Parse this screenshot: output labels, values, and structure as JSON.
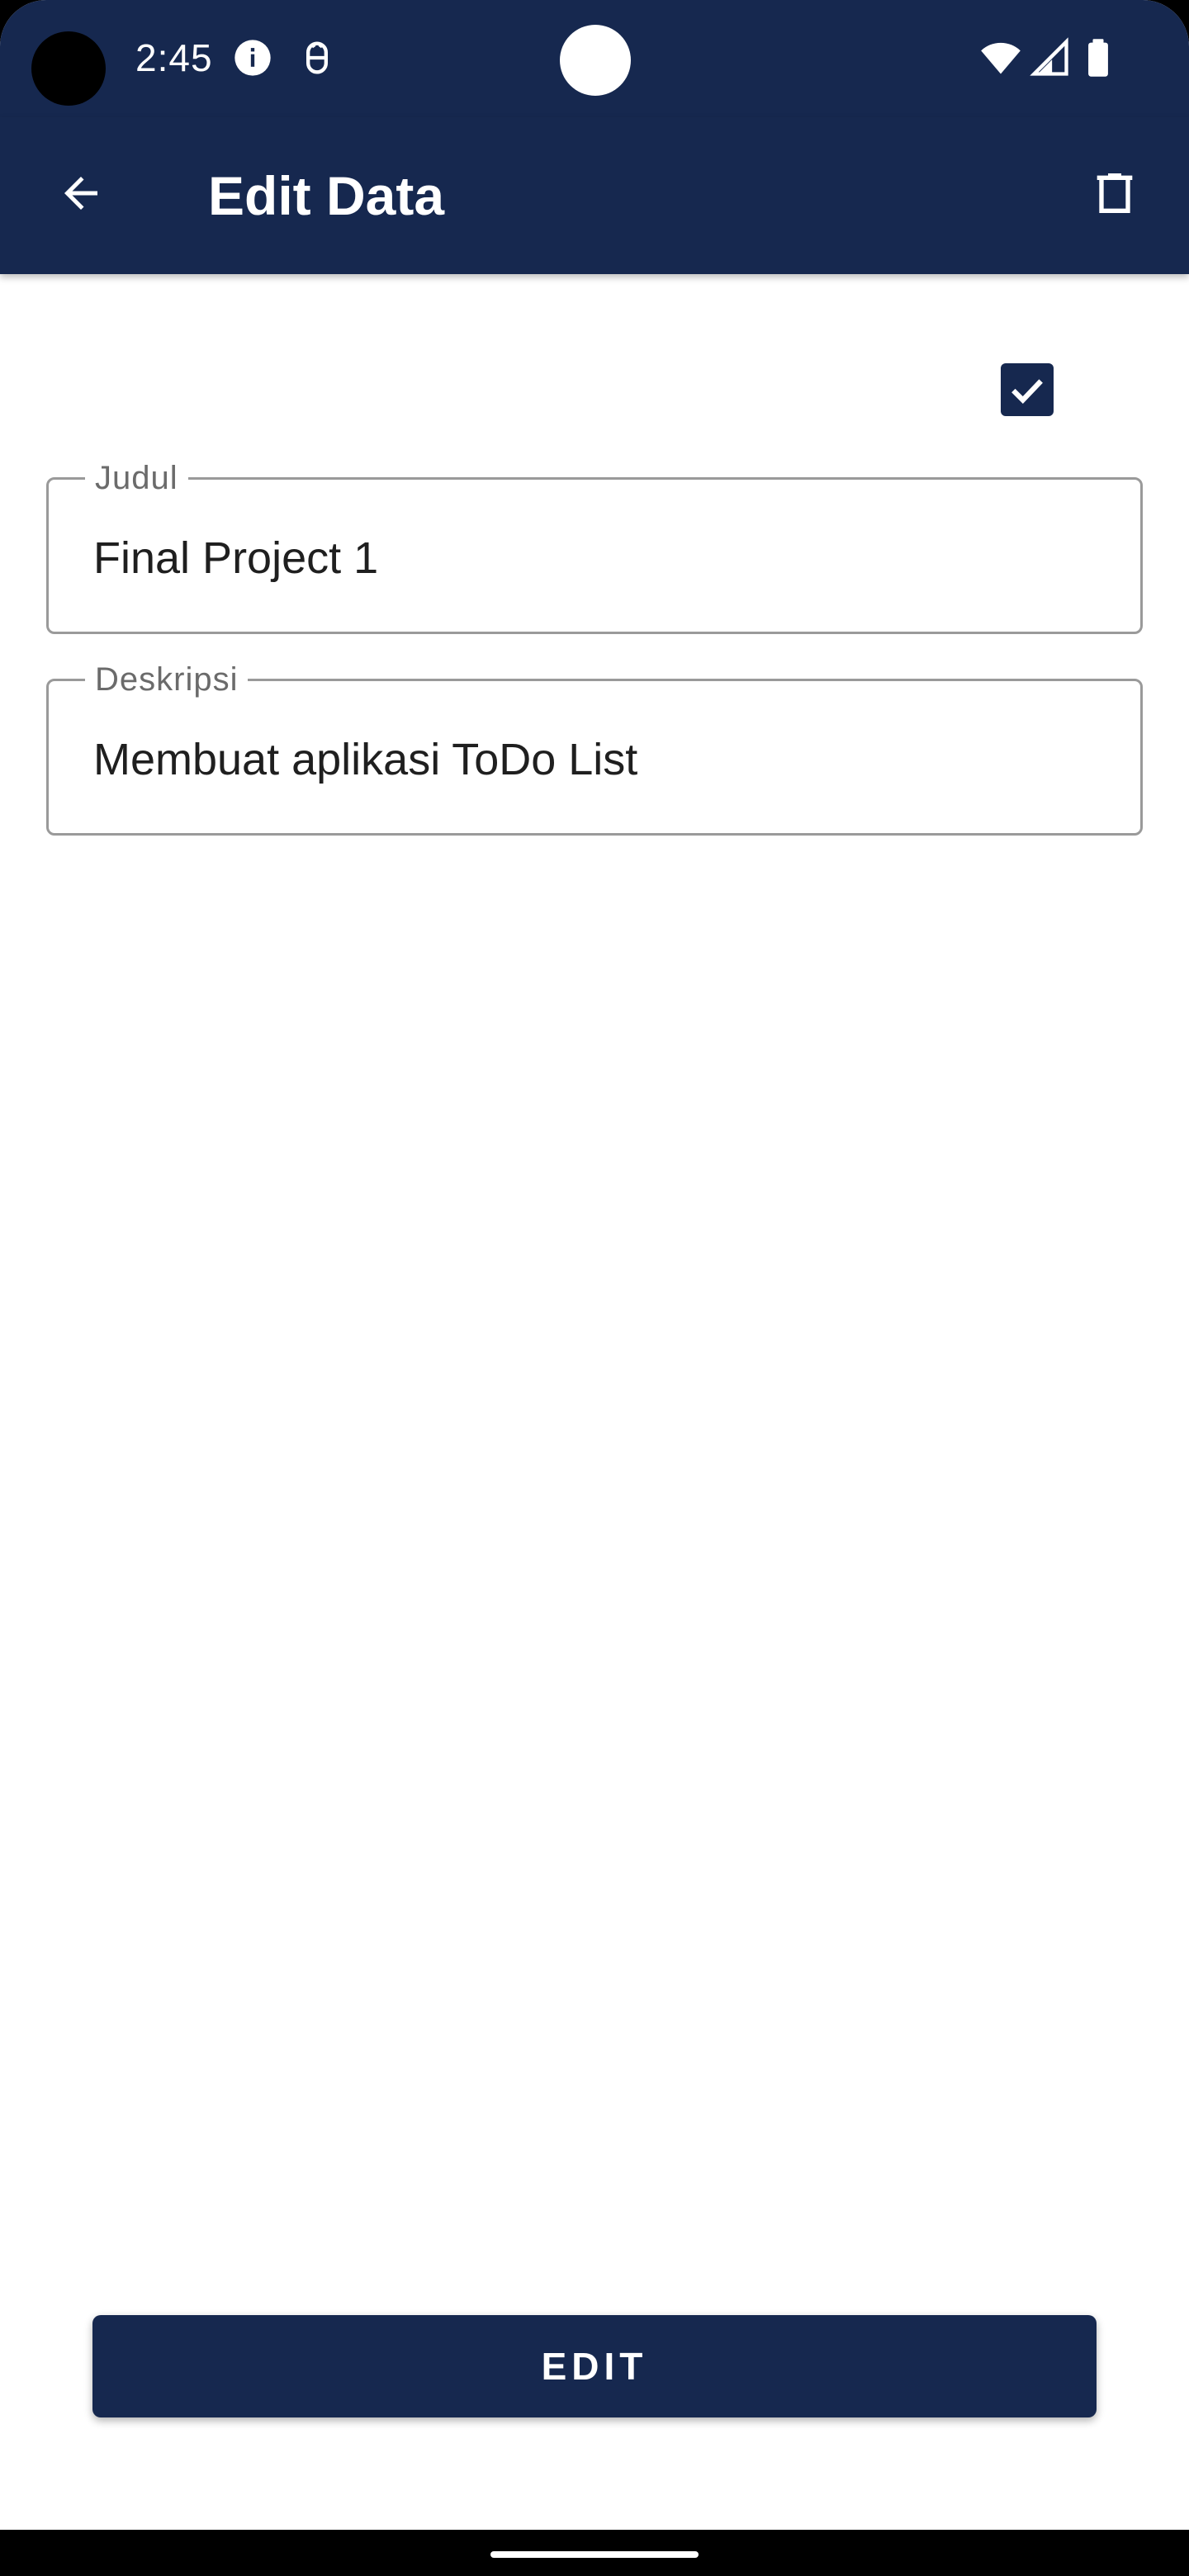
{
  "status_bar": {
    "time": "2:45",
    "icons": [
      "info-icon",
      "bug-icon",
      "wifi-icon",
      "signal-icon",
      "battery-icon"
    ]
  },
  "app_bar": {
    "title": "Edit Data",
    "back_icon": "arrow-left-icon",
    "delete_icon": "trash-icon"
  },
  "form": {
    "completed_checked": true,
    "title_field": {
      "label": "Judul",
      "value": "Final Project 1"
    },
    "description_field": {
      "label": "Deskripsi",
      "value": "Membuat aplikasi ToDo List"
    }
  },
  "actions": {
    "edit_label": "EDIT"
  },
  "colors": {
    "primary": "#16284f",
    "field_border": "#9a9a9a",
    "label_text": "#6b6b6b",
    "value_text": "#1f1f1f"
  }
}
